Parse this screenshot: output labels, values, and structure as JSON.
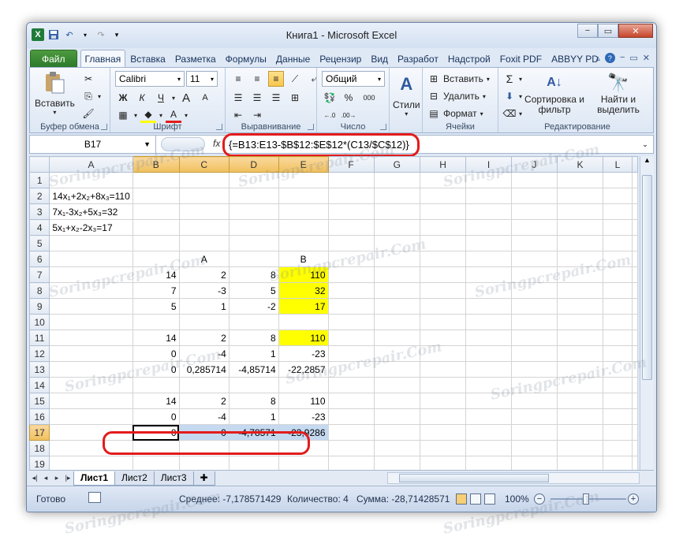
{
  "window": {
    "title": "Книга1 - Microsoft Excel",
    "minimize": "−",
    "restore": "▭",
    "close": "✕"
  },
  "ribbon_tabs": [
    "Файл",
    "Главная",
    "Вставка",
    "Разметка",
    "Формулы",
    "Данные",
    "Рецензир",
    "Вид",
    "Разработ",
    "Надстрой",
    "Foxit PDF",
    "ABBYY PD"
  ],
  "ribbon": {
    "clipboard": {
      "label": "Буфер обмена",
      "paste": "Вставить"
    },
    "font": {
      "label": "Шрифт",
      "name": "Calibri",
      "size": "11",
      "bold": "Ж",
      "italic": "К",
      "underline": "Ч"
    },
    "alignment": {
      "label": "Выравнивание"
    },
    "number": {
      "label": "Число",
      "format": "Общий",
      "percent": "%",
      "thousands": "000"
    },
    "styles": {
      "label": "Стили",
      "button": "Стили"
    },
    "cells": {
      "label": "Ячейки",
      "insert": "Вставить",
      "delete": "Удалить",
      "format": "Формат"
    },
    "editing": {
      "label": "Редактирование",
      "sum": "Σ",
      "sort": "Сортировка и фильтр",
      "find": "Найти и выделить"
    }
  },
  "formula_bar": {
    "name_box": "B17",
    "fx": "fx",
    "formula": "{=B13:E13-$B$12:$E$12*(C13/$C$12)}"
  },
  "columns": [
    "A",
    "B",
    "C",
    "D",
    "E",
    "F",
    "G",
    "H",
    "I",
    "J",
    "K",
    "L"
  ],
  "rows": [
    {
      "r": "1",
      "cells": [
        "",
        "",
        "",
        "",
        "",
        "",
        "",
        "",
        "",
        "",
        "",
        ""
      ]
    },
    {
      "r": "2",
      "cells": [
        "14x₁+2x₂+8x₃=110",
        "",
        "",
        "",
        "",
        "",
        "",
        "",
        "",
        "",
        "",
        ""
      ]
    },
    {
      "r": "3",
      "cells": [
        "7x₁-3x₂+5x₃=32",
        "",
        "",
        "",
        "",
        "",
        "",
        "",
        "",
        "",
        "",
        ""
      ]
    },
    {
      "r": "4",
      "cells": [
        "5x₁+x₂-2x₃=17",
        "",
        "",
        "",
        "",
        "",
        "",
        "",
        "",
        "",
        "",
        ""
      ]
    },
    {
      "r": "5",
      "cells": [
        "",
        "",
        "",
        "",
        "",
        "",
        "",
        "",
        "",
        "",
        "",
        ""
      ]
    },
    {
      "r": "6",
      "cells": [
        "",
        "",
        "A",
        "",
        "B",
        "",
        "",
        "",
        "",
        "",
        "",
        ""
      ]
    },
    {
      "r": "7",
      "cells": [
        "",
        "14",
        "2",
        "8",
        "110",
        "",
        "",
        "",
        "",
        "",
        "",
        ""
      ]
    },
    {
      "r": "8",
      "cells": [
        "",
        "7",
        "-3",
        "5",
        "32",
        "",
        "",
        "",
        "",
        "",
        "",
        ""
      ]
    },
    {
      "r": "9",
      "cells": [
        "",
        "5",
        "1",
        "-2",
        "17",
        "",
        "",
        "",
        "",
        "",
        "",
        ""
      ]
    },
    {
      "r": "10",
      "cells": [
        "",
        "",
        "",
        "",
        "",
        "",
        "",
        "",
        "",
        "",
        "",
        ""
      ]
    },
    {
      "r": "11",
      "cells": [
        "",
        "14",
        "2",
        "8",
        "110",
        "",
        "",
        "",
        "",
        "",
        "",
        ""
      ]
    },
    {
      "r": "12",
      "cells": [
        "",
        "0",
        "-4",
        "1",
        "-23",
        "",
        "",
        "",
        "",
        "",
        "",
        ""
      ]
    },
    {
      "r": "13",
      "cells": [
        "",
        "0",
        "0,285714",
        "-4,85714",
        "-22,2857",
        "",
        "",
        "",
        "",
        "",
        "",
        ""
      ]
    },
    {
      "r": "14",
      "cells": [
        "",
        "",
        "",
        "",
        "",
        "",
        "",
        "",
        "",
        "",
        "",
        ""
      ]
    },
    {
      "r": "15",
      "cells": [
        "",
        "14",
        "2",
        "8",
        "110",
        "",
        "",
        "",
        "",
        "",
        "",
        ""
      ]
    },
    {
      "r": "16",
      "cells": [
        "",
        "0",
        "-4",
        "1",
        "-23",
        "",
        "",
        "",
        "",
        "",
        "",
        ""
      ]
    },
    {
      "r": "17",
      "cells": [
        "",
        "0",
        "0",
        "-4,78571",
        "-23,9286",
        "",
        "",
        "",
        "",
        "",
        "",
        ""
      ]
    },
    {
      "r": "18",
      "cells": [
        "",
        "",
        "",
        "",
        "",
        "",
        "",
        "",
        "",
        "",
        "",
        ""
      ]
    },
    {
      "r": "19",
      "cells": [
        "",
        "",
        "",
        "",
        "",
        "",
        "",
        "",
        "",
        "",
        "",
        ""
      ]
    }
  ],
  "sheet_tabs": [
    "Лист1",
    "Лист2",
    "Лист3"
  ],
  "status_bar": {
    "ready": "Готово",
    "average": "Среднее: -7,178571429",
    "count": "Количество: 4",
    "sum": "Сумма: -28,71428571",
    "zoom": "100%",
    "zoom_minus": "−",
    "zoom_plus": "+"
  },
  "watermark_text": "Soringpcrepair.Com",
  "colors": {
    "highlight_yellow": "#ffff00",
    "selection": "#c5d9f1",
    "annotation_red": "#e31b1b"
  }
}
